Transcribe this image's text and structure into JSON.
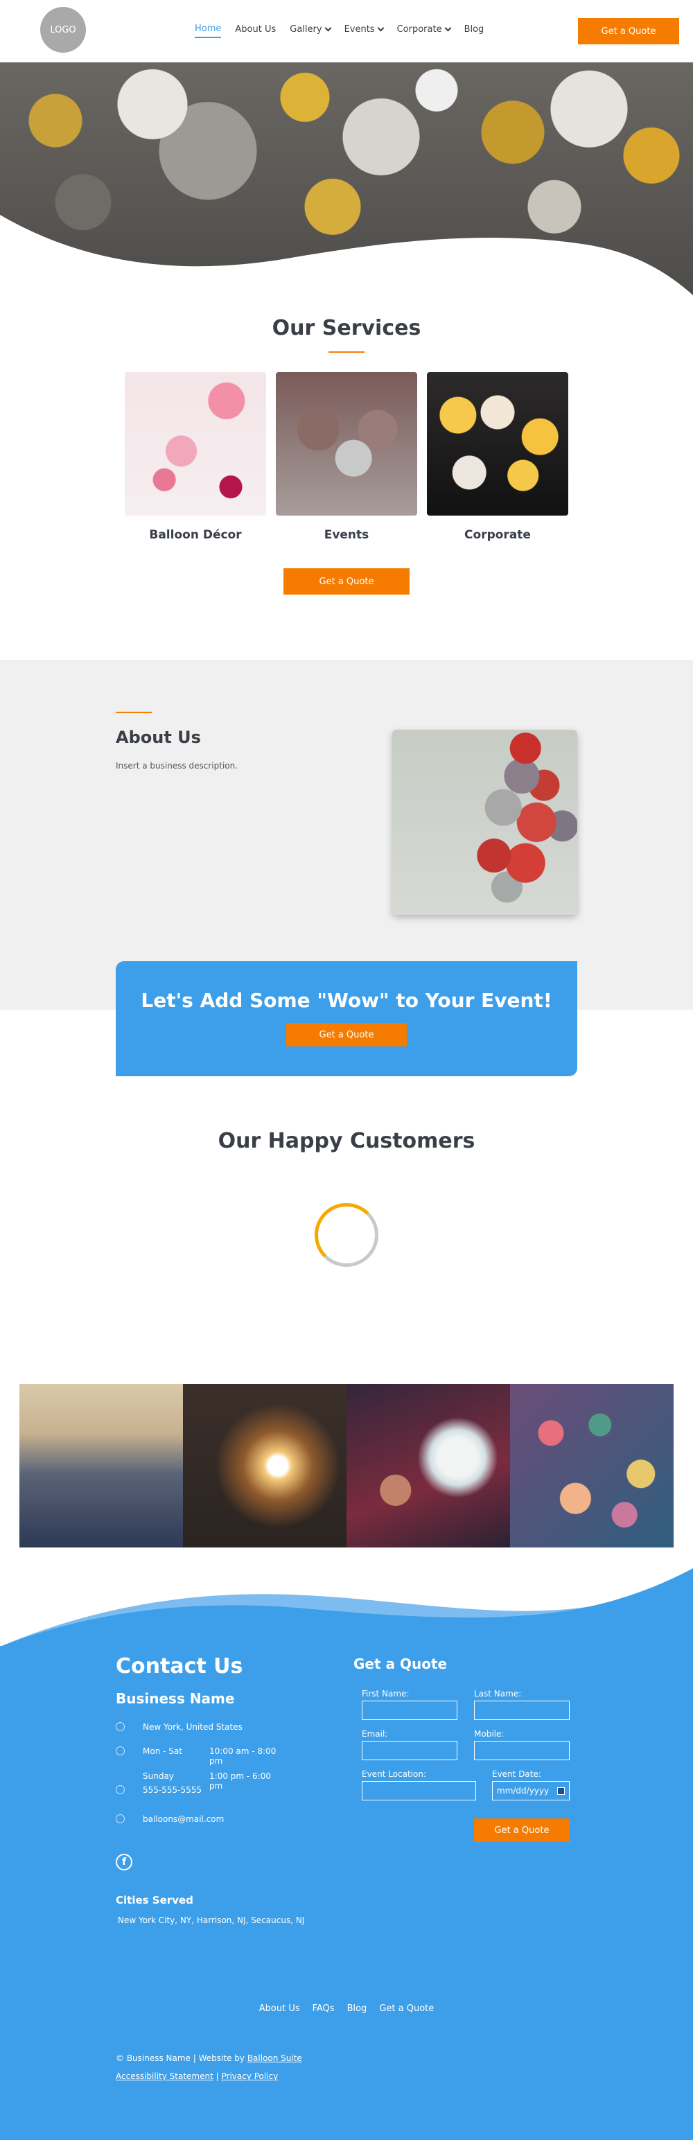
{
  "header": {
    "logo_text": "LOGO",
    "nav": [
      {
        "label": "Home",
        "active": true,
        "dropdown": false
      },
      {
        "label": "About Us",
        "active": false,
        "dropdown": false
      },
      {
        "label": "Gallery",
        "active": false,
        "dropdown": true
      },
      {
        "label": "Events",
        "active": false,
        "dropdown": true
      },
      {
        "label": "Corporate",
        "active": false,
        "dropdown": true
      },
      {
        "label": "Blog",
        "active": false,
        "dropdown": false
      }
    ],
    "cta_label": "Get a Quote"
  },
  "services": {
    "title": "Our Services",
    "items": [
      {
        "label": "Balloon Décor"
      },
      {
        "label": "Events"
      },
      {
        "label": "Corporate"
      }
    ],
    "cta_label": "Get a Quote"
  },
  "about": {
    "title": "About Us",
    "description": "Insert a business description."
  },
  "cta_banner": {
    "title": "Let's Add Some \"Wow\" to Your Event!",
    "button_label": "Get a Quote"
  },
  "customers": {
    "title": "Our Happy Customers"
  },
  "contact": {
    "title": "Contact Us",
    "business_name": "Business Name",
    "location": "New York, United States",
    "hours": [
      {
        "days": "Mon - Sat",
        "time": "10:00 am - 8:00 pm"
      },
      {
        "days": "Sunday",
        "time": "1:00 pm - 6:00 pm"
      }
    ],
    "phone": "555-555-5555",
    "email": "balloons@mail.com",
    "facebook_glyph": "f",
    "cities_title": "Cities Served",
    "cities": "New York City, NY, Harrison, NJ, Secaucus, NJ"
  },
  "quote_form": {
    "title": "Get a Quote",
    "first_name_label": "First Name:",
    "last_name_label": "Last Name:",
    "email_label": "Email:",
    "mobile_label": "Mobile:",
    "location_label": "Event Location:",
    "date_label": "Event Date:",
    "date_placeholder": "mm/dd/yyyy",
    "submit_label": "Get a Quote"
  },
  "footer": {
    "links": [
      "About Us",
      "FAQs",
      "Blog",
      "Get a Quote"
    ],
    "copyright_prefix": "© Business Name | Website by ",
    "credit_link": "Balloon Suite",
    "accessibility_link": "Accessibility Statement",
    "separator": " | ",
    "privacy_link": "Privacy Policy"
  },
  "colors": {
    "accent_orange": "#f57c00",
    "brand_blue": "#3d9fe9",
    "nav_active_blue": "#3d9be9",
    "light_gray": "#f0f0f0"
  }
}
